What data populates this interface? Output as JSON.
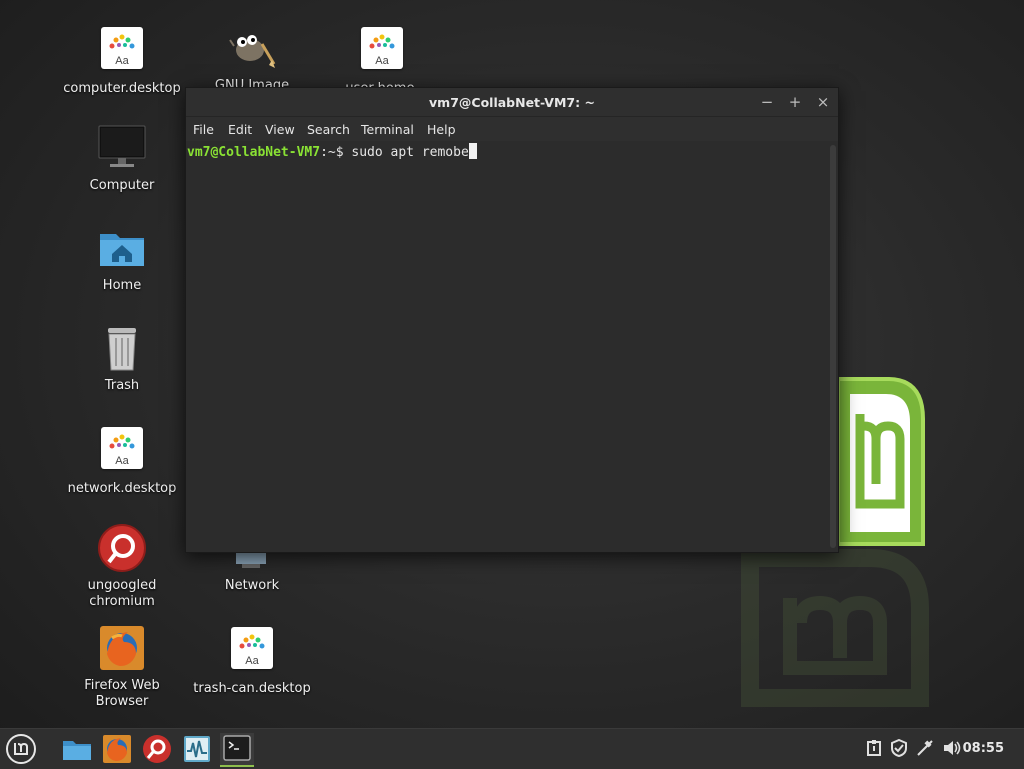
{
  "desktop": {
    "icons": [
      {
        "label": "computer.desktop"
      },
      {
        "label": "GNU Image"
      },
      {
        "label": "user-home."
      },
      {
        "label": "Computer"
      },
      {
        "label": "Home"
      },
      {
        "label": "Trash"
      },
      {
        "label": "network.desktop"
      },
      {
        "label": "ungoogled\nchromium"
      },
      {
        "label": "Network"
      },
      {
        "label": "Firefox Web\nBrowser"
      },
      {
        "label": "trash-can.desktop"
      }
    ],
    "font_icon_text": "Aa"
  },
  "terminal": {
    "title": "vm7@CollabNet-VM7: ~",
    "menu": [
      "File",
      "Edit",
      "View",
      "Search",
      "Terminal",
      "Help"
    ],
    "prompt_user": "vm7@CollabNet-VM7",
    "prompt_sep": ":~$ ",
    "command": "sudo apt remobe",
    "controls": {
      "minimize": "−",
      "maximize": "+",
      "close": "×"
    }
  },
  "taskbar": {
    "clock": "08:55"
  },
  "colors": {
    "prompt_green": "#8ae234",
    "mint_green": "#8fbf4d"
  }
}
